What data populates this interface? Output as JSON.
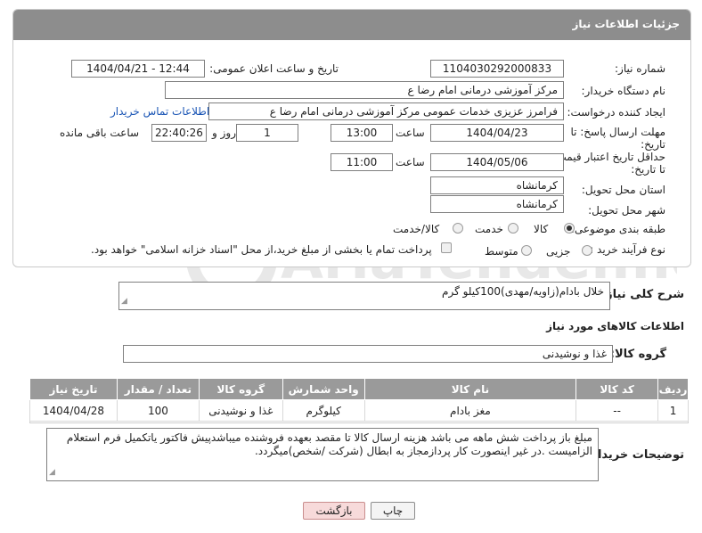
{
  "header": {
    "title": "جزئیات اطلاعات نیاز"
  },
  "form": {
    "need_number_label": "شماره نیاز:",
    "need_number": "1104030292000833",
    "announce_label": "تاریخ و ساعت اعلان عمومی:",
    "announce_value": "1404/04/21 - 12:44",
    "buyer_org_label": "نام دستگاه خریدار:",
    "buyer_org": "مرکز آموزشی  درمانی امام رضا  ع",
    "creator_label": "ایجاد کننده درخواست:",
    "creator": "فرامرز عزیزی خدمات عمومی مرکز آموزشی  درمانی امام رضا  ع",
    "contact_link": "اطلاعات تماس خریدار",
    "deadline_label_1": "مهلت ارسال پاسخ: تا",
    "deadline_label_2": "تاریخ:",
    "deadline_date": "1404/04/23",
    "hour_label": "ساعت",
    "deadline_time": "13:00",
    "days_value": "1",
    "days_label": "روز و",
    "remaining_time": "22:40:26",
    "remaining_label": "ساعت باقی مانده",
    "validity_label_1": "حداقل تاریخ اعتبار قیمت:",
    "validity_label_2": "تا تاریخ:",
    "validity_date": "1404/05/06",
    "validity_time": "11:00",
    "province_label": "استان محل تحویل:",
    "province": "کرمانشاه",
    "city_label": "شهر محل تحویل:",
    "city": "کرمانشاه",
    "category_label": "طبقه بندی موضوعی:",
    "category_options": [
      "کالا",
      "خدمت",
      "کالا/خدمت"
    ],
    "category_selected": "کالا",
    "process_label": "نوع فرآیند خرید :",
    "process_options": [
      "جزیی",
      "متوسط"
    ],
    "payment_note": "پرداخت تمام یا بخشی از مبلغ خرید،از محل \"اسناد خزانه اسلامی\" خواهد بود."
  },
  "summary": {
    "label": "شرح کلی نیاز:",
    "text": "خلال بادام(زاویه/مهدی)100کیلو گرم"
  },
  "items_section": {
    "title": "اطلاعات کالاهای مورد نیاز",
    "group_label": "گروه کالا:",
    "group_value": "غذا و نوشیدنی"
  },
  "table": {
    "headers": [
      "ردیف",
      "کد کالا",
      "نام کالا",
      "واحد شمارش",
      "گروه کالا",
      "تعداد / مقدار",
      "تاریخ نیاز"
    ],
    "rows": [
      [
        "1",
        "--",
        "مغز بادام",
        "کیلوگرم",
        "غذا و نوشیدنی",
        "100",
        "1404/04/28"
      ]
    ]
  },
  "buyer_notes": {
    "label": "توضیحات خریدار:",
    "text": "مبلغ باز پرداخت شش ماهه می باشد هزینه ارسال کالا تا مقصد بعهده فروشنده میباشدپیش فاکتور یاتکمیل فرم استعلام الزامیست .در غیر اینصورت کار پردازمجاز به ابطال (شرکت /شخص)میگردد."
  },
  "buttons": {
    "print": "چاپ",
    "back": "بازگشت"
  },
  "watermark": {
    "text": "AriaTender.neT"
  },
  "colors": {
    "header_bg": "#8d8d8d",
    "link": "#1a55b5",
    "back_button": "#f7dada"
  }
}
